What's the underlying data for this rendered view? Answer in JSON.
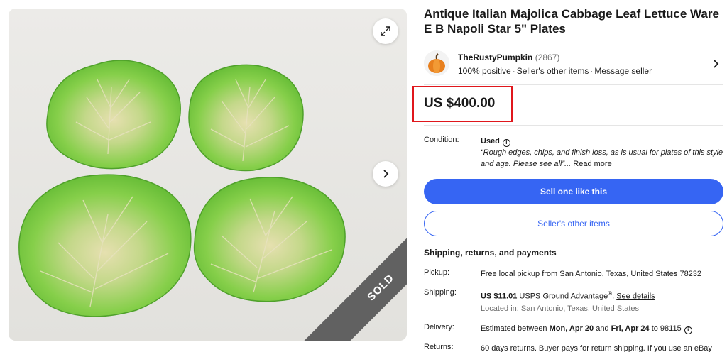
{
  "gallery": {
    "sold_label": "SOLD",
    "icons": {
      "expand": "expand-icon",
      "next": "chevron-right-icon"
    }
  },
  "listing": {
    "title": "Antique Italian Majolica Cabbage Leaf Lettuce Ware E B Napoli Star 5\" Plates"
  },
  "seller": {
    "name": "TheRustyPumpkin",
    "feedback_count": "(2867)",
    "positive": "100% positive",
    "other_items": "Seller's other items",
    "message": "Message seller",
    "separator": "·"
  },
  "price": {
    "value": "US $400.00",
    "highlight_color": "#e0171c"
  },
  "condition": {
    "label": "Condition:",
    "value": "Used",
    "info_icon": "i",
    "description": "“Rough edges, chips, and finish loss, as is usual for plates of this style and age. Please see all”...",
    "read_more": "Read more"
  },
  "buttons": {
    "sell_one": "Sell one like this",
    "other_items": "Seller's other items",
    "primary_color": "#3665f3"
  },
  "shipping": {
    "heading": "Shipping, returns, and payments",
    "pickup_label": "Pickup:",
    "pickup_text": "Free local pickup from ",
    "pickup_location": "San Antonio, Texas, United States 78232",
    "shipping_label": "Shipping:",
    "shipping_price": "US $11.01",
    "shipping_service": " USPS Ground Advantage",
    "shipping_reg": "®",
    "shipping_dot": ". ",
    "see_details": "See details",
    "located_in": "Located in: San Antonio, Texas, United States",
    "delivery_label": "Delivery:",
    "delivery_prefix": "Estimated between ",
    "delivery_start": "Mon, Apr 20",
    "delivery_and": " and ",
    "delivery_end": "Fri, Apr 24",
    "delivery_to": " to 98115",
    "delivery_icon": "i",
    "returns_label": "Returns:",
    "returns_text": "60 days returns. Buyer pays for return shipping. If you use an eBay"
  }
}
